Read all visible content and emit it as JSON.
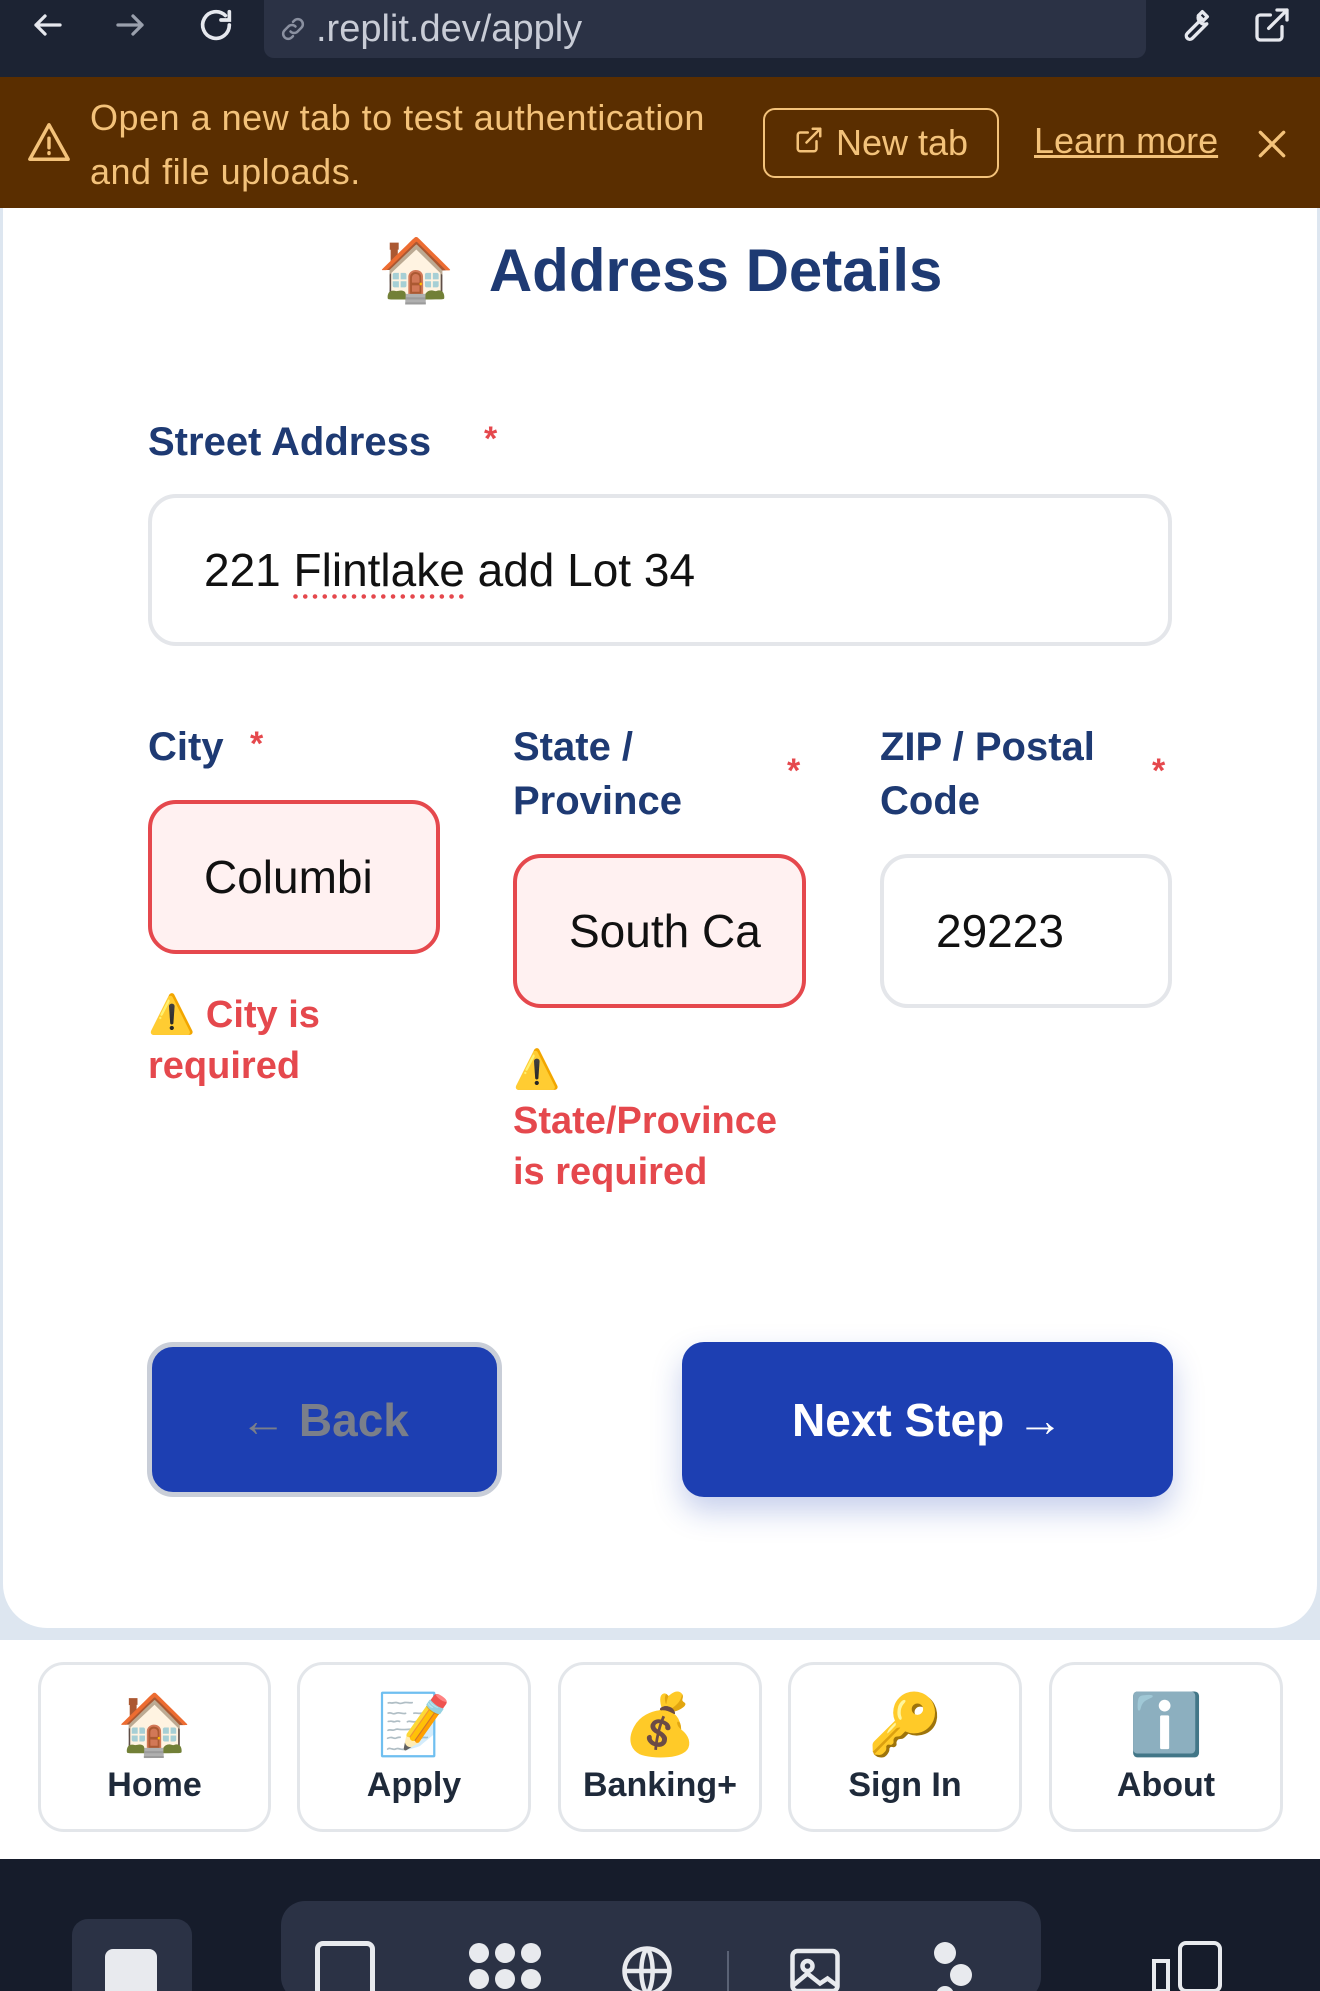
{
  "browser": {
    "url": ".replit.dev/apply"
  },
  "banner": {
    "message_line1": "Open a new tab to test authentication",
    "message_line2": "and file uploads.",
    "new_tab_label": "New tab",
    "learn_more_label": "Learn more"
  },
  "form": {
    "title_emoji": "🏠",
    "title": "Address Details",
    "required_marker": "*",
    "street": {
      "label": "Street Address",
      "value_word1": "221",
      "value_word2": "Flintlake",
      "value_rest": "add Lot 34"
    },
    "city": {
      "label": "City",
      "value": "Columbi",
      "error_icon": "⚠️",
      "error": "City is required"
    },
    "state": {
      "label_line1": "State /",
      "label_line2": "Province",
      "value": "South Ca",
      "error_icon": "⚠️",
      "error": "State/Province is required"
    },
    "zip": {
      "label_line1": "ZIP / Postal",
      "label_line2": "Code",
      "value": "29223"
    },
    "back_label": "← Back",
    "next_label": "Next Step →"
  },
  "bottom_nav": [
    {
      "emoji": "🏠",
      "label": "Home"
    },
    {
      "emoji": "📝",
      "label": "Apply"
    },
    {
      "emoji": "💰",
      "label": "Banking+"
    },
    {
      "emoji": "🔑",
      "label": "Sign In"
    },
    {
      "emoji": "ℹ️",
      "label": "About"
    }
  ],
  "colors": {
    "brand_navy": "#1e3a73",
    "button_blue": "#1d3fb2",
    "error_red": "#e5484d",
    "banner_bg": "#5a2e00",
    "banner_text": "#f3c27a"
  }
}
